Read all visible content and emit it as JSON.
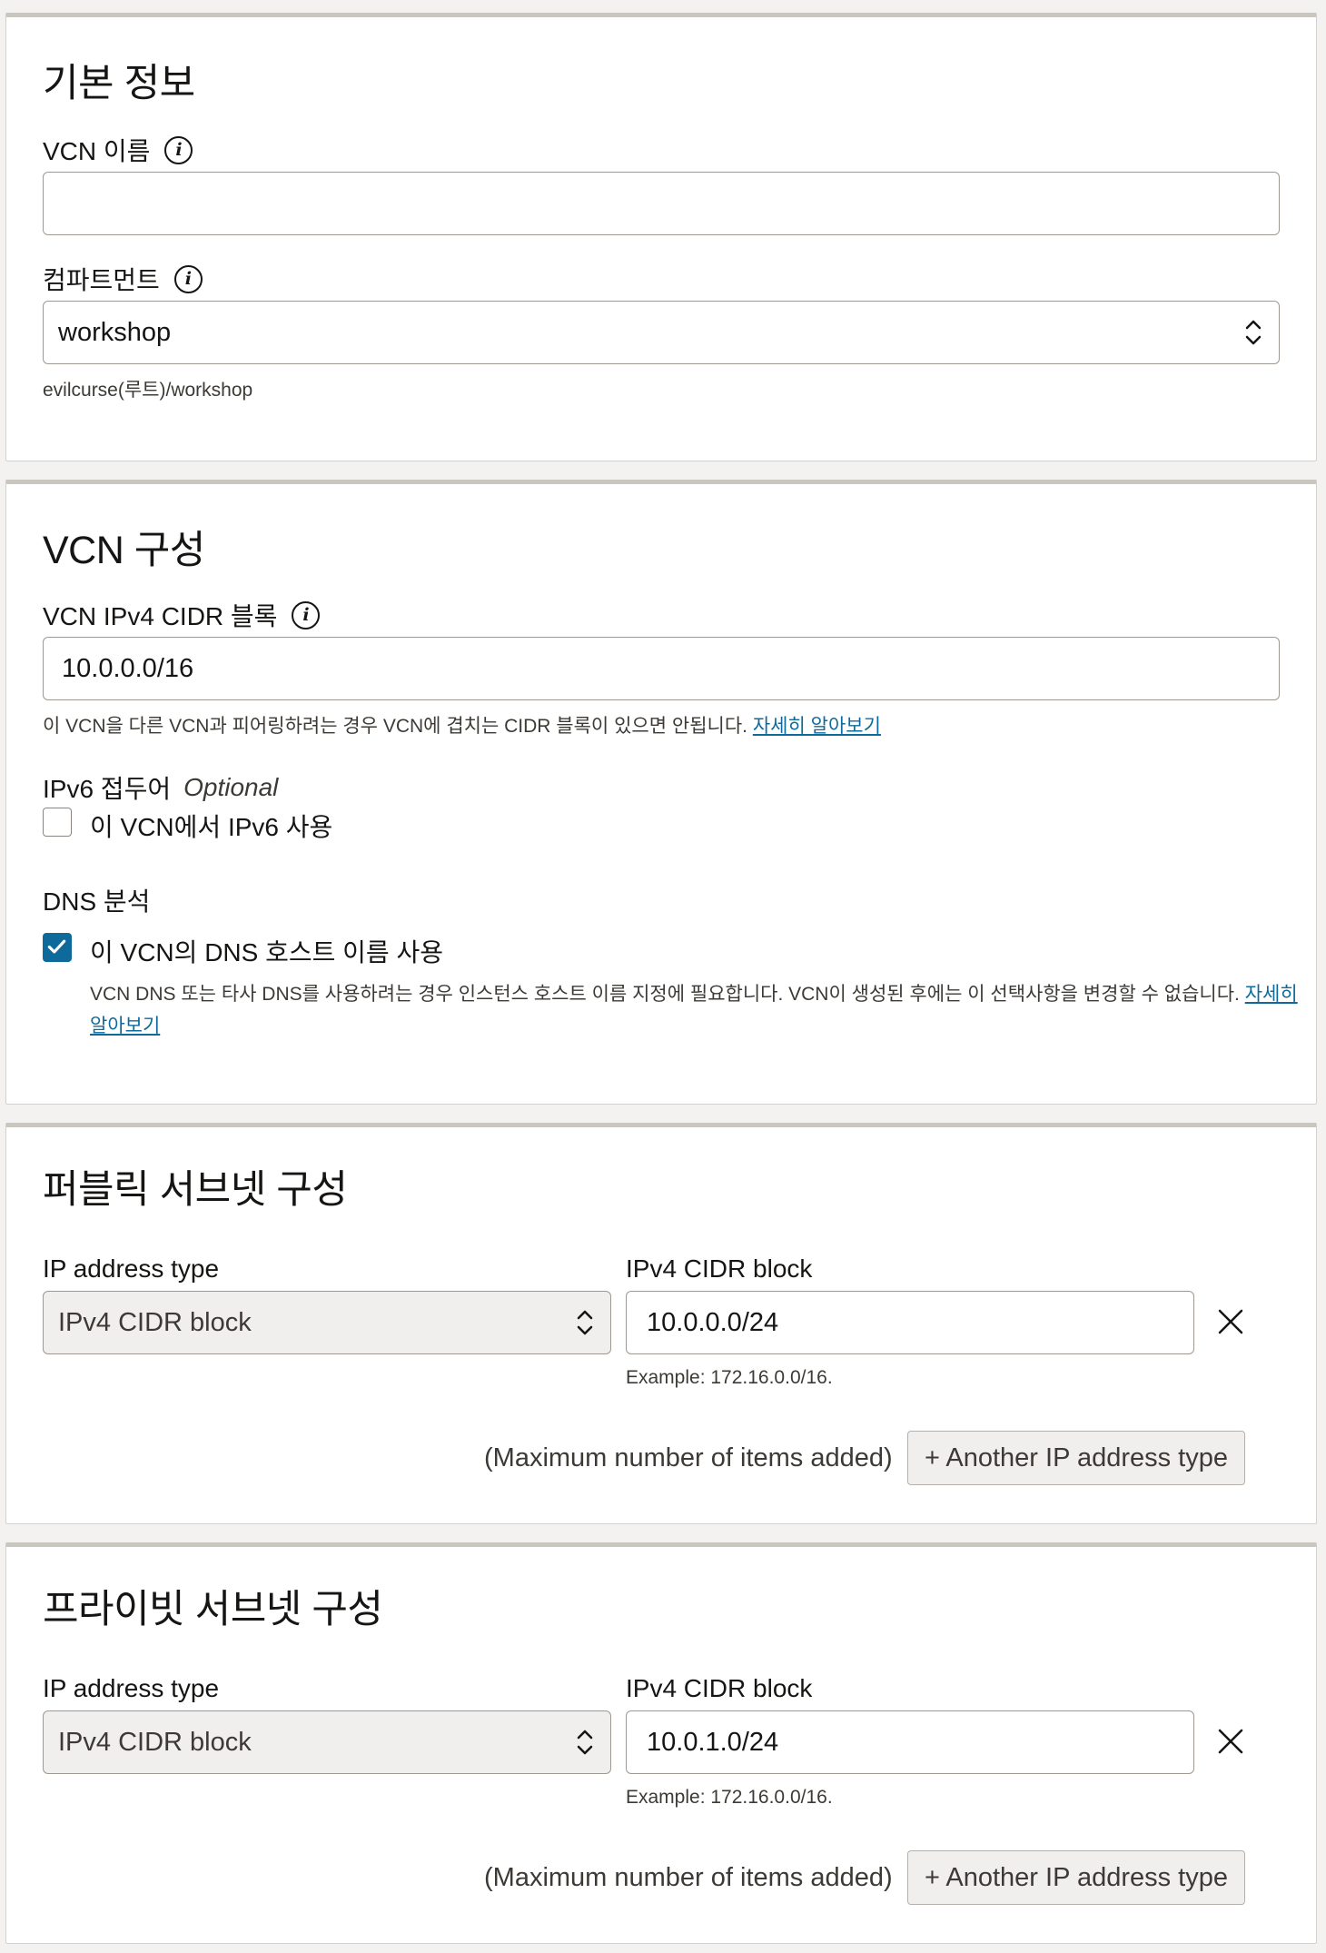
{
  "basic": {
    "title": "기본 정보",
    "vcn_name_label": "VCN 이름",
    "vcn_name_value": "",
    "compartment_label": "컴파트먼트",
    "compartment_value": "workshop",
    "compartment_path": "evilcurse(루트)/workshop"
  },
  "vcn_config": {
    "title": "VCN 구성",
    "cidr_label": "VCN IPv4 CIDR 블록",
    "cidr_value": "10.0.0.0/16",
    "cidr_hint": "이 VCN을 다른 VCN과 피어링하려는 경우 VCN에 겹치는 CIDR 블록이 있으면 안됩니다.",
    "cidr_hint_link": "자세히 알아보기",
    "ipv6_label": "IPv6 접두어",
    "ipv6_optional": "Optional",
    "ipv6_checkbox_label": "이 VCN에서 IPv6 사용",
    "ipv6_checked": false,
    "dns_label": "DNS 분석",
    "dns_checkbox_label": "이 VCN의 DNS 호스트 이름 사용",
    "dns_checked": true,
    "dns_hint": "VCN DNS 또는 타사 DNS를 사용하려는 경우 인스턴스 호스트 이름 지정에 필요합니다. VCN이 생성된 후에는 이 선택사항을 변경할 수 없습니다.",
    "dns_hint_link_1": "자세히",
    "dns_hint_link_2": "알아보기"
  },
  "public_subnet": {
    "title": "퍼블릭 서브넷 구성",
    "ip_type_label": "IP address type",
    "ip_type_value": "IPv4 CIDR block",
    "cidr_label": "IPv4 CIDR block",
    "cidr_value": "10.0.0.0/24",
    "example": "Example: 172.16.0.0/16.",
    "max_note": "(Maximum number of items added)",
    "add_button": "+ Another IP address type"
  },
  "private_subnet": {
    "title": "프라이빗 서브넷 구성",
    "ip_type_label": "IP address type",
    "ip_type_value": "IPv4 CIDR block",
    "cidr_label": "IPv4 CIDR block",
    "cidr_value": "10.0.1.0/24",
    "example": "Example: 172.16.0.0/16.",
    "max_note": "(Maximum number of items added)",
    "add_button": "+ Another IP address type"
  },
  "colors": {
    "accent": "#0f6a9c",
    "border": "#9e9892",
    "card_top": "#c9c5bf"
  }
}
